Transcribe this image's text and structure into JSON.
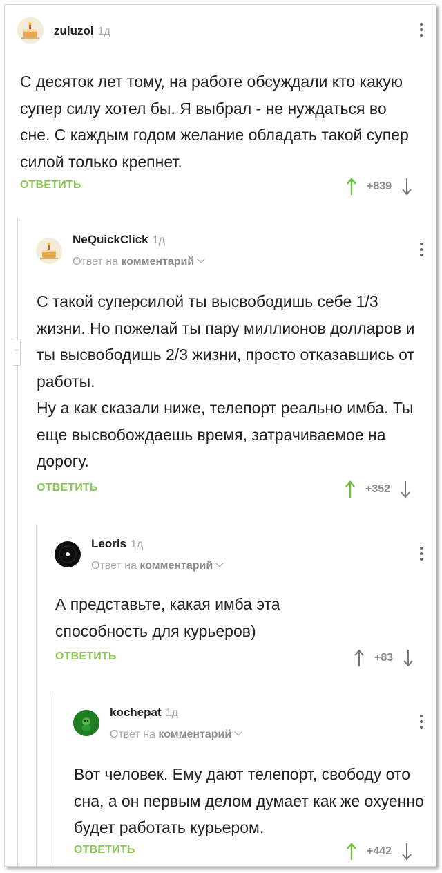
{
  "colors": {
    "reply": "#8ac858",
    "vote_up_active": "#6bbf3a",
    "vote_up": "#777777",
    "vote_down": "#777777"
  },
  "comments": [
    {
      "author": "zuluzol",
      "time": "1д",
      "avatar_icon": "cake-avatar-icon",
      "text": "С десяток лет тому, на работе обсуждали кто какую супер силу хотел бы. Я выбрал - не нуждаться во сне. С каждым годом желание обладать такой супер силой только крепнет.",
      "reply_label": "ОТВЕТИТЬ",
      "score": "+839",
      "upvoted": true
    },
    {
      "author": "NeQuickClick",
      "time": "1д",
      "avatar_icon": "cake-avatar-icon",
      "reply_to_prefix": "Ответ на",
      "reply_to_target": "комментарий",
      "text": "С такой суперсилой ты высвободишь себе 1/3 жизни. Но пожелай ты пару миллионов долларов и ты высвободишь 2/3 жизни, просто отказавшись от работы.\nНу а как сказали ниже, телепорт реально имба. Ты еще высвобождаешь время, затрачиваемое на дорогу.",
      "reply_label": "ОТВЕТИТЬ",
      "score": "+352",
      "upvoted": true
    },
    {
      "author": "Leoris",
      "time": "1д",
      "avatar_icon": "vinyl-avatar-icon",
      "reply_to_prefix": "Ответ на",
      "reply_to_target": "комментарий",
      "text": "А представьте, какая имба эта способность для курьеров)",
      "reply_label": "ОТВЕТИТЬ",
      "score": "+83",
      "upvoted": false
    },
    {
      "author": "kochepat",
      "time": "1д",
      "avatar_icon": "green-avatar-icon",
      "reply_to_prefix": "Ответ на",
      "reply_to_target": "комментарий",
      "text": "Вот человек. Ему дают телепорт, свободу ото сна, а он первым делом думает как же охуенно будет работать курьером.",
      "reply_label": "ОТВЕТИТЬ",
      "score": "+442",
      "upvoted": true
    }
  ]
}
